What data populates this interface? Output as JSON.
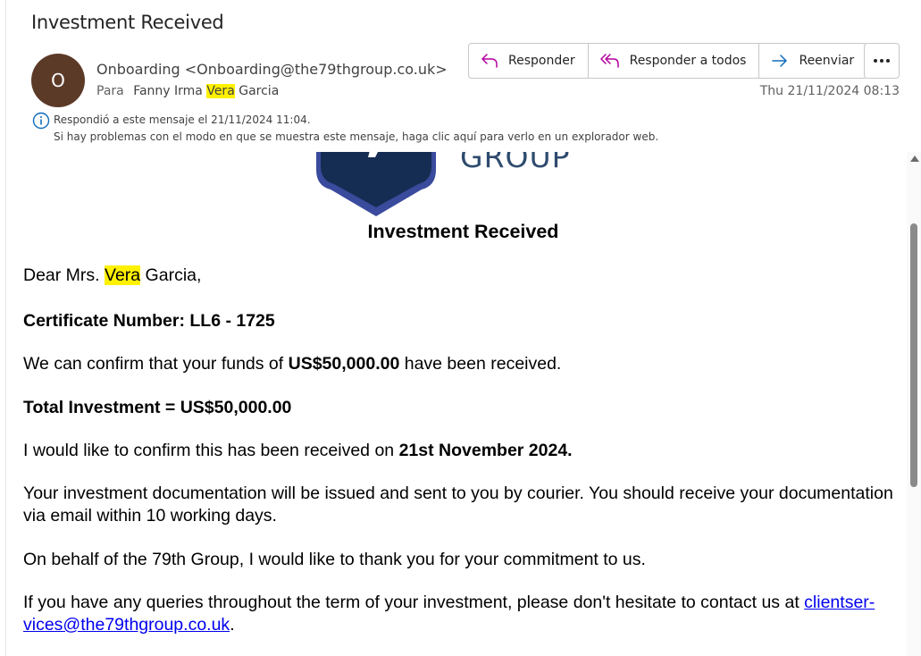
{
  "email": {
    "subject": "Investment Received",
    "avatar_initial": "O",
    "sender": "Onboarding <Onboarding@the79thgroup.co.uk>",
    "to_label": "Para",
    "recipient": {
      "first": "Fanny Irma ",
      "highlight": "Vera",
      "last": " Garcia"
    },
    "date": "Thu 21/11/2024 08:13",
    "info_line1": "Respondió a este mensaje el 21/11/2024 11:04.",
    "info_line2": "Si hay problemas con el modo en que se muestra este mensaje, haga clic aquí para verlo en un explorador web."
  },
  "actions": {
    "reply": "Responder",
    "reply_all": "Responder a todos",
    "forward": "Reenviar"
  },
  "body": {
    "logo_text": "GROUP",
    "title": "Investment Received",
    "greeting_pre": "Dear Mrs. ",
    "greeting_hl": "Vera",
    "greeting_post": " Garcia,",
    "certificate": "Certificate Number: LL6 - 1725",
    "confirm_pre": "We can confirm that your funds of ",
    "confirm_amount": "US$50,000.00",
    "confirm_post": " have been received.",
    "total": "Total Investment = US$50,000.00",
    "received_pre": "I would like to confirm this has been received on ",
    "received_date": "21st November 2024.",
    "documentation": "Your investment documentation will be issued and sent to you by courier. You should receive your documentation via email within 10 working days.",
    "thanks": "On behalf of the 79th Group, I would like to thank you for your commitment to us.",
    "queries_pre": "If you have any queries throughout the term of your investment, please don't hesitate to contact us at ",
    "queries_link": "clientser-vices@the79thgroup.co.uk",
    "queries_post": "."
  },
  "colors": {
    "avatar": "#5c3a28",
    "highlight": "#fff100",
    "accent_icon": "#0f6cbd",
    "reply_icon": "#b4009e"
  }
}
